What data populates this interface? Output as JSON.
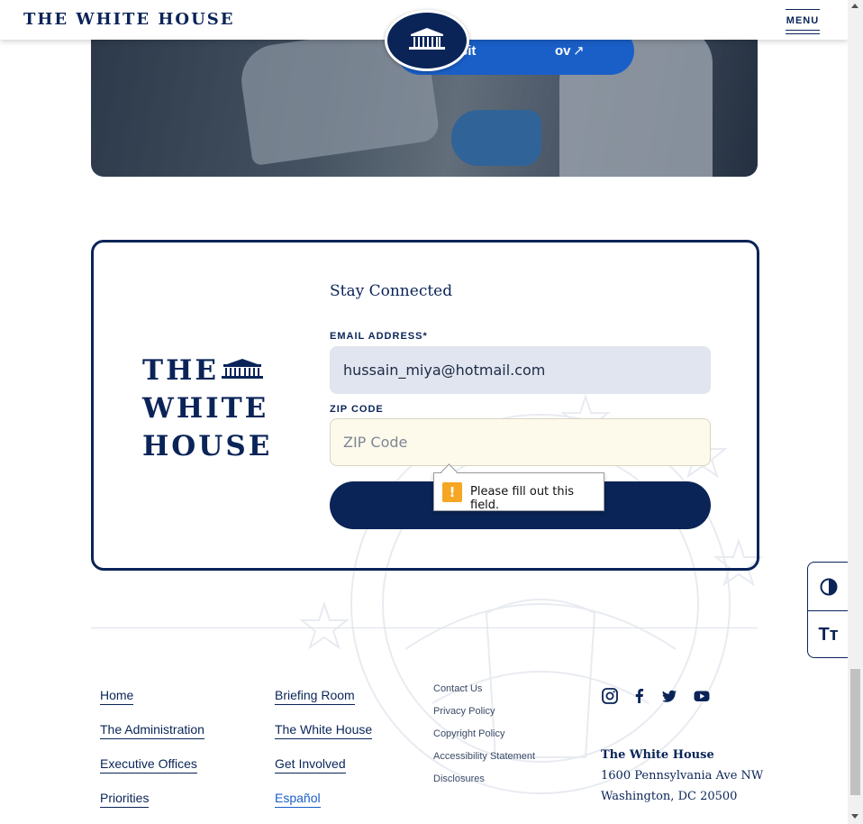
{
  "header": {
    "brand": "THE WHITE HOUSE",
    "menu_label": "MENU"
  },
  "hero": {
    "button_label_start": "Visit",
    "button_label_end": "ov",
    "arrow_icon": "external-arrow-icon"
  },
  "signup": {
    "title": "Stay Connected",
    "logo_lines": [
      "THE",
      "WHITE",
      "HOUSE"
    ],
    "email_label": "EMAIL ADDRESS*",
    "email_value": "hussain_miya@hotmail.com",
    "zip_label": "ZIP CODE",
    "zip_placeholder": "ZIP Code",
    "validation_message": "Please fill out this field."
  },
  "tools": {
    "contrast_icon": "contrast-icon",
    "text_size_label": "Tт"
  },
  "footer": {
    "col1": [
      "Home",
      "The Administration",
      "Executive Offices",
      "Priorities"
    ],
    "col2": [
      "Briefing Room",
      "The White House",
      "Get Involved",
      "Español"
    ],
    "col3": [
      "Contact Us",
      "Privacy Policy",
      "Copyright Policy",
      "Accessibility Statement",
      "Disclosures"
    ],
    "social": [
      "instagram-icon",
      "facebook-icon",
      "twitter-icon",
      "youtube-icon"
    ],
    "address": {
      "name": "The White House",
      "street": "1600 Pennsylvania Ave NW",
      "city": "Washington, DC 20500"
    }
  },
  "colors": {
    "navy": "#0a2458",
    "accent_blue": "#1a5fc8",
    "zip_background": "#fdfaeb",
    "email_background": "#e1e5ef",
    "warning": "#f5a623"
  }
}
